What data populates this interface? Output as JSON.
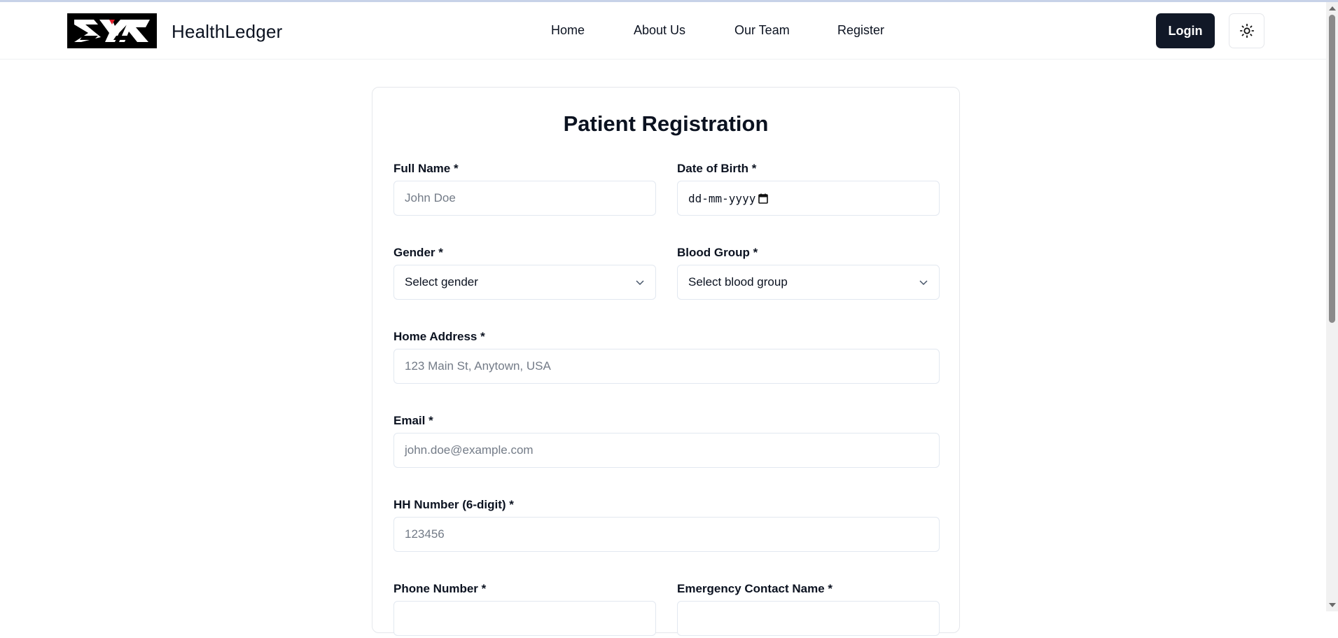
{
  "header": {
    "brand": "HealthLedger",
    "nav": [
      "Home",
      "About Us",
      "Our Team",
      "Register"
    ],
    "login_label": "Login"
  },
  "form": {
    "title": "Patient Registration",
    "full_name": {
      "label": "Full Name *",
      "placeholder": "John Doe"
    },
    "dob": {
      "label": "Date of Birth *",
      "value": "dd-mm-yyyy"
    },
    "gender": {
      "label": "Gender *",
      "value": "Select gender"
    },
    "blood_group": {
      "label": "Blood Group *",
      "value": "Select blood group"
    },
    "address": {
      "label": "Home Address *",
      "placeholder": "123 Main St, Anytown, USA"
    },
    "email": {
      "label": "Email *",
      "placeholder": "john.doe@example.com"
    },
    "hh_number": {
      "label": "HH Number (6-digit) *",
      "placeholder": "123456"
    },
    "phone": {
      "label": "Phone Number *"
    },
    "emergency_name": {
      "label": "Emergency Contact Name *"
    }
  },
  "icons": {
    "theme": "sun-icon",
    "dropdown": "chevron-down-icon",
    "calendar": "calendar-icon"
  },
  "colors": {
    "primary_button": "#111827",
    "border": "#e2e8f0",
    "placeholder": "#737b87"
  }
}
